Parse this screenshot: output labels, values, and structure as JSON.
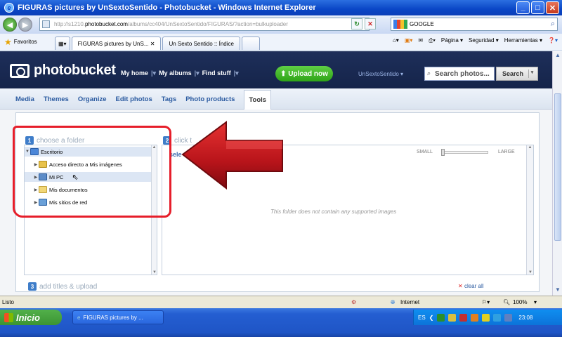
{
  "window": {
    "title": "FIGURAS pictures by UnSextoSentido - Photobucket - Windows Internet Explorer",
    "controls": [
      "minimize",
      "maximize",
      "close"
    ]
  },
  "address_bar": {
    "url_prefix": "http://s1210.",
    "url_domain": "photobucket.com",
    "url_path": "/albums/cc404/UnSextoSentido/FIGURAS/?action=bulkuploader",
    "search_engine": "GOOGLE"
  },
  "favorites_bar": {
    "favorites_label": "Favoritos",
    "tabs": [
      {
        "label": "FIGURAS pictures by UnS...",
        "active": true
      },
      {
        "label": "Un Sexto Sentido :: Índice",
        "active": false
      }
    ],
    "commands": [
      "Página ▾",
      "Seguridad ▾",
      "Herramientas ▾"
    ]
  },
  "photobucket": {
    "logo": "photobucket",
    "nav": [
      "My home",
      "My albums",
      "Find stuff"
    ],
    "upload_label": "Upload now",
    "user_label": "UnSextoSentido ▾",
    "search_placeholder": "Search photos...",
    "search_button": "Search",
    "subnav": [
      "Media",
      "Themes",
      "Organize",
      "Edit photos",
      "Tags",
      "Photo products",
      "Tools"
    ],
    "subnav_selected": "Tools"
  },
  "uploader": {
    "step1": {
      "num": "1",
      "label": "choose a folder"
    },
    "step2": {
      "num": "2",
      "label": "click t"
    },
    "step3": {
      "num": "3",
      "label": "add titles & upload"
    },
    "select_label": "sele",
    "size_small": "SMALL",
    "size_large": "LARGE",
    "empty_message": "This folder does not contain any supported images",
    "clear_all": "clear all",
    "tree": [
      {
        "label": "Escritorio",
        "level": 0,
        "expanded": true,
        "icon": "desktop-icon"
      },
      {
        "label": "Acceso directo a Mis imágenes",
        "level": 1,
        "icon": "shortcut-folder-icon"
      },
      {
        "label": "Mi PC",
        "level": 1,
        "icon": "computer-icon"
      },
      {
        "label": "Mis documentos",
        "level": 1,
        "icon": "folder-icon"
      },
      {
        "label": "Mis sitios de red",
        "level": 1,
        "icon": "network-icon"
      }
    ]
  },
  "statusbar": {
    "left": "Listo",
    "zone": "Internet",
    "zoom": "100%"
  },
  "taskbar": {
    "start_label": "Inicio",
    "task_label": "FIGURAS pictures by ...",
    "lang": "ES",
    "clock": "23:08"
  },
  "colors": {
    "annotation_red": "#e61e2a",
    "pb_header": "#1e2f5a",
    "upload_green": "#2ea316",
    "link_blue": "#2a5aa0"
  }
}
